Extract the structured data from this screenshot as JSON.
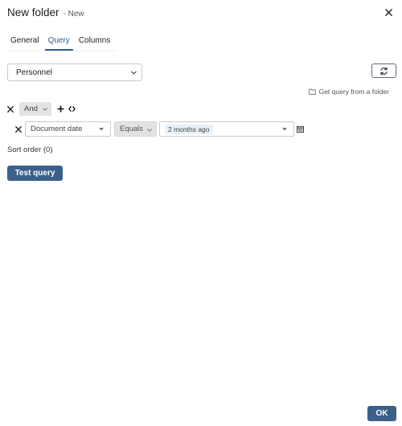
{
  "dialog": {
    "title": "New folder",
    "subtitle": "- New",
    "close_icon": "close-icon"
  },
  "tabs": [
    {
      "label": "General",
      "active": false
    },
    {
      "label": "Query",
      "active": true
    },
    {
      "label": "Columns",
      "active": false
    }
  ],
  "source_select": {
    "value": "Personnel",
    "icon": "chevron-down-icon"
  },
  "refresh_button": {
    "icon": "refresh-icon"
  },
  "get_query_link": {
    "label": "Get query from a folder",
    "icon": "folder-icon"
  },
  "query": {
    "group_operator": "And",
    "add_icon": "plus-icon",
    "code_icon": "code-icon",
    "conditions": [
      {
        "field": "Document date",
        "operator": "Equals",
        "value": "2 months ago",
        "value_icon": "calendar-icon"
      }
    ]
  },
  "sort_order_label": "Sort order (0)",
  "test_query_label": "Test query",
  "ok_label": "OK",
  "colors": {
    "primary": "#3d6089",
    "tab_active": "#2f5d94",
    "chip": "#e6f0f7",
    "disabled_bg": "#e3e3e3"
  }
}
